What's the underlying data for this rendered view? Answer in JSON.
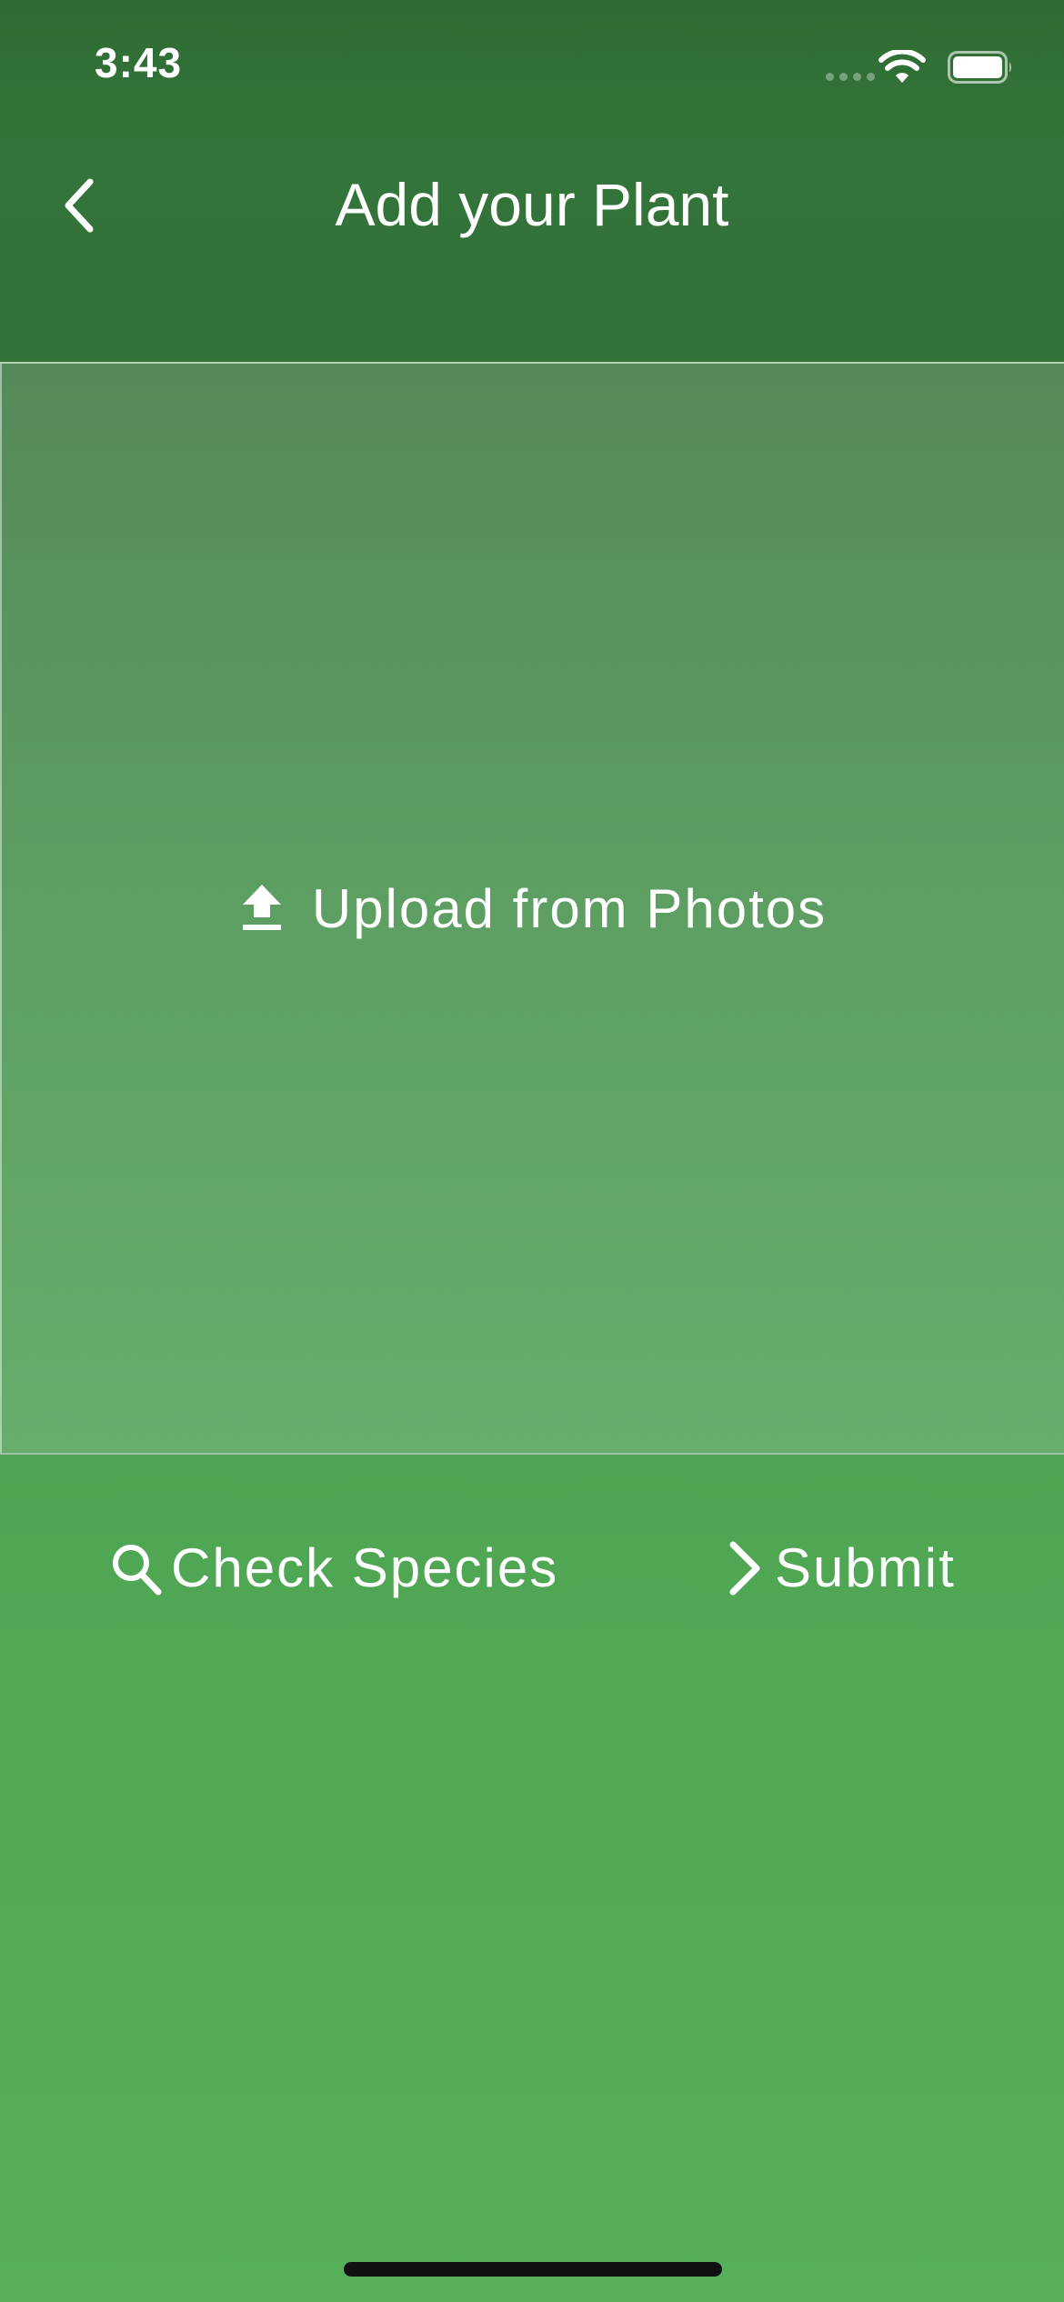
{
  "status_bar": {
    "time": "3:43",
    "wifi_icon": "wifi-icon",
    "battery_icon": "battery-icon"
  },
  "nav": {
    "back_icon": "chevron-left-icon",
    "title": "Add your Plant"
  },
  "upload": {
    "icon": "upload-icon",
    "label": "Upload from Photos"
  },
  "actions": {
    "check_species": {
      "icon": "search-icon",
      "label": "Check Species"
    },
    "submit": {
      "icon": "chevron-right-icon",
      "label": "Submit"
    }
  },
  "colors": {
    "header_green": "#33743a",
    "background_green_bottom": "#55b059",
    "text": "#ffffff"
  }
}
